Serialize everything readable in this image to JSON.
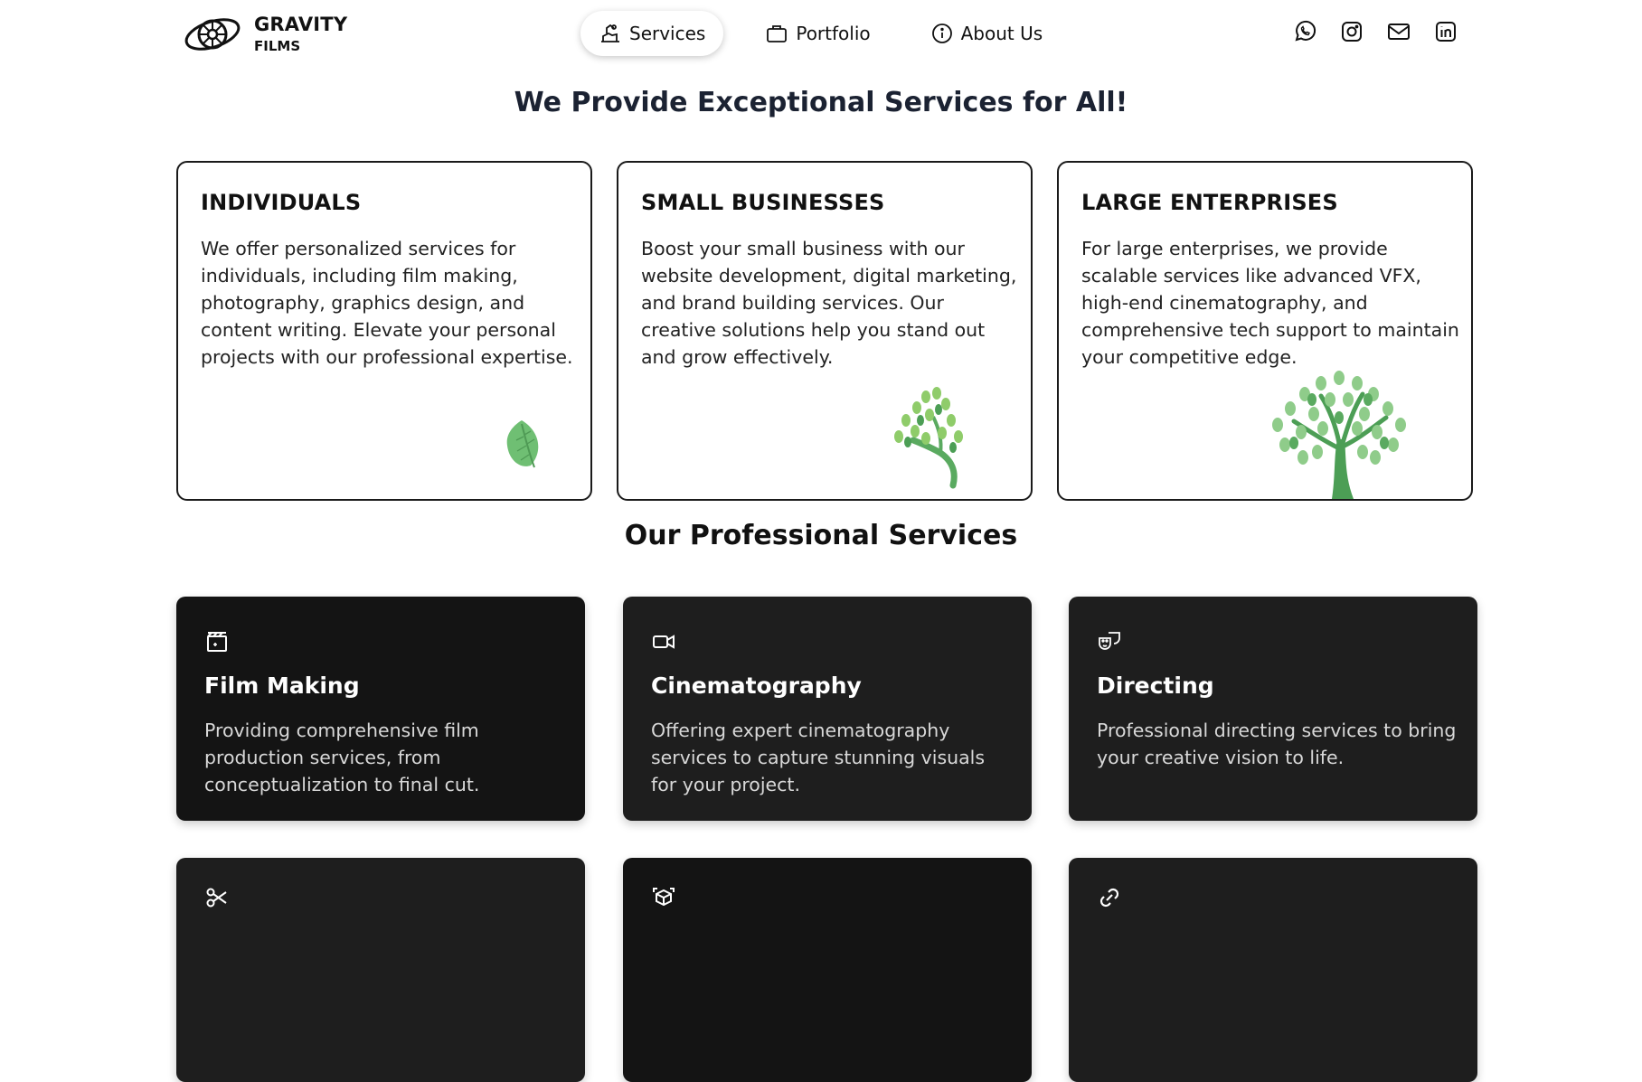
{
  "brand": {
    "name": "GRAVITY",
    "sub": "FILMS",
    "logo_icon": "film-reel-logo-icon"
  },
  "nav": {
    "items": [
      {
        "label": "Services",
        "icon": "services-icon",
        "active": true
      },
      {
        "label": "Portfolio",
        "icon": "briefcase-icon",
        "active": false
      },
      {
        "label": "About Us",
        "icon": "info-icon",
        "active": false
      }
    ]
  },
  "socials": [
    "whatsapp-icon",
    "instagram-icon",
    "mail-icon",
    "linkedin-icon"
  ],
  "hero": {
    "title": "We Provide Exceptional Services for All!"
  },
  "audiences": [
    {
      "title": "INDIVIDUALS",
      "text": "We offer personalized services for individuals, including film making, photography, graphics design, and content writing. Elevate your personal projects with our professional expertise.",
      "art": "leaf-icon"
    },
    {
      "title": "SMALL BUSINESSES",
      "text": "Boost your small business with our website development, digital marketing, and brand building services. Our creative solutions help you stand out and grow effectively.",
      "art": "sapling-icon"
    },
    {
      "title": "LARGE ENTERPRISES",
      "text": "For large enterprises, we provide scalable services like advanced VFX, high-end cinematography, and comprehensive tech support to maintain your competitive edge.",
      "art": "tree-icon"
    }
  ],
  "services_heading": "Our Professional Services",
  "services": [
    {
      "title": "Film Making",
      "text": "Providing comprehensive film production services, from conceptualization to final cut.",
      "icon": "clapperboard-icon"
    },
    {
      "title": "Cinematography",
      "text": "Offering expert cinematography services to capture stunning visuals for your project.",
      "icon": "video-camera-icon"
    },
    {
      "title": "Directing",
      "text": "Professional directing services to bring your creative vision to life.",
      "icon": "theater-masks-icon"
    },
    {
      "title": "",
      "text": "",
      "icon": "scissors-icon"
    },
    {
      "title": "",
      "text": "",
      "icon": "3d-cube-icon"
    },
    {
      "title": "",
      "text": "",
      "icon": "link-icon"
    }
  ],
  "colors": {
    "card_dark": "#141414",
    "leaf_green": "#6fbf73",
    "tree_green": "#4c9e55",
    "heading": "#1b2232"
  }
}
